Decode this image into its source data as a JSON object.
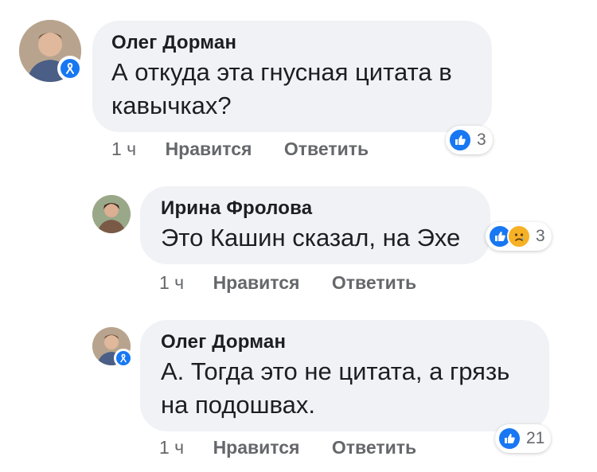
{
  "comments": [
    {
      "author": "Олег Дорман",
      "text": "А откуда эта гнусная цитата в кавычках?",
      "time": "1 ч",
      "like_label": "Нравится",
      "reply_label": "Ответить",
      "reactions": [
        "like"
      ],
      "reaction_count": "3"
    },
    {
      "author": "Ирина Фролова",
      "text": "Это Кашин сказал, на Эхе",
      "time": "1 ч",
      "like_label": "Нравится",
      "reply_label": "Ответить",
      "reactions": [
        "like",
        "sad"
      ],
      "reaction_count": "3"
    },
    {
      "author": "Олег Дорман",
      "text": "А. Тогда это не цитата, а грязь на подошвах.",
      "time": "1 ч",
      "like_label": "Нравится",
      "reply_label": "Ответить",
      "reactions": [
        "like"
      ],
      "reaction_count": "21"
    }
  ],
  "colors": {
    "bubble": "#f0f2f5",
    "accent_blue": "#1877f2",
    "meta_gray": "#65676b",
    "sad_yellow": "#f7b125"
  }
}
